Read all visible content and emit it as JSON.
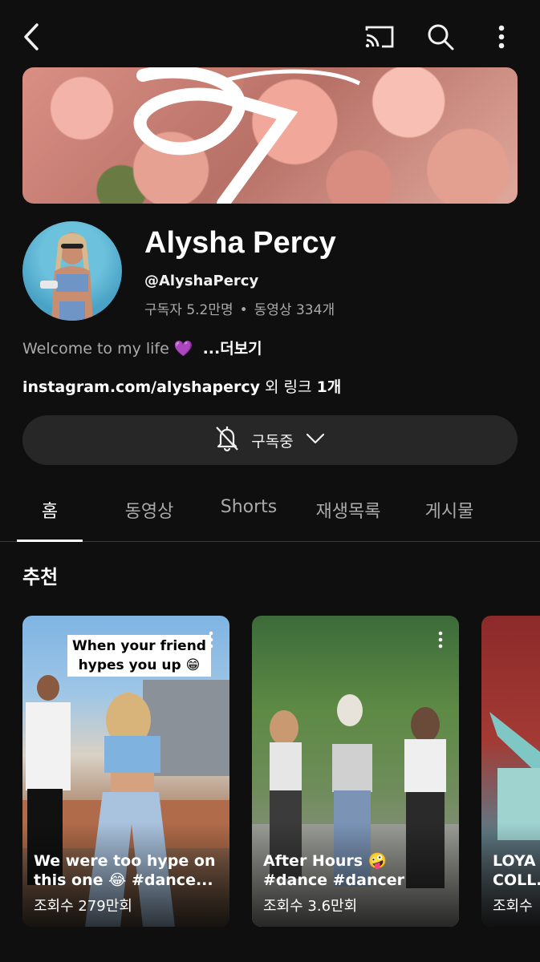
{
  "topbar": {
    "icons": [
      "back-icon",
      "cast-icon",
      "search-icon",
      "more-vert-icon"
    ]
  },
  "channel": {
    "name": "Alysha Percy",
    "handle": "@AlyshaPercy",
    "subscribers": "구독자 5.2만명",
    "dot": "•",
    "videos": "동영상 334개",
    "description": "Welcome to my life",
    "heart": "💜",
    "more_label": "...더보기",
    "link_url": "instagram.com/alyshapercy",
    "link_suffix": " 외 링크 ",
    "link_count": "1개",
    "banner_logo": "A"
  },
  "subscribe": {
    "label": "구독중",
    "icons": [
      "bell-off-icon",
      "chevron-down-icon"
    ]
  },
  "tabs": [
    {
      "label": "홈",
      "active": true
    },
    {
      "label": "동영상",
      "active": false
    },
    {
      "label": "Shorts",
      "active": false
    },
    {
      "label": "재생목록",
      "active": false
    },
    {
      "label": "게시물",
      "active": false
    }
  ],
  "section": {
    "title": "추천"
  },
  "shorts": [
    {
      "overlay_caption": "When your friend\nhypes you up 😁",
      "title": "We were too hype on this one 😂 #dance...",
      "views": "조회수 279만회"
    },
    {
      "title": "After Hours 🤪 #dance #dancer #d...",
      "views": "조회수 3.6만회"
    },
    {
      "title": "LOYA COLL...",
      "views": "조회수"
    }
  ],
  "colors": {
    "background": "#0f0f0f",
    "button_bg": "#272727",
    "secondary_text": "#aaaaaa"
  }
}
